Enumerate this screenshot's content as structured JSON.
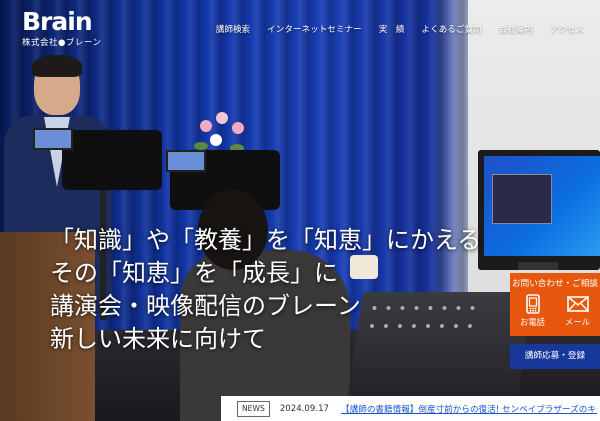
{
  "brand": {
    "logo_word": "Brain",
    "company_name": "株式会社●ブレーン"
  },
  "nav": {
    "items": [
      {
        "label": "講師検索"
      },
      {
        "label": "インターネットセミナー"
      },
      {
        "label": "実　績"
      },
      {
        "label": "よくあるご質問"
      },
      {
        "label": "会社案内"
      },
      {
        "label": "アクセス"
      }
    ]
  },
  "hero": {
    "lines": [
      "「知識」や「教養」を「知恵」にかえる",
      "その「知恵」を「成長」に",
      "講演会・映像配信のブレーン",
      "新しい未来に向けて"
    ]
  },
  "contact": {
    "title": "お問い合わせ・ご相談",
    "phone_label": "お電話",
    "mail_label": "メール",
    "phone_icon": "phone-icon",
    "mail_icon": "mail-icon"
  },
  "instructor_button": "講師応募・登録",
  "news": {
    "tag": "NEWS",
    "date": "2024.09.17",
    "title": "【講師の書籍情報】倒産寸前からの復活! センベイブラザーズのキセキ"
  },
  "colors": {
    "accent_orange": "#e8570e",
    "accent_navy": "#17379b",
    "link_blue": "#1a56c8"
  }
}
